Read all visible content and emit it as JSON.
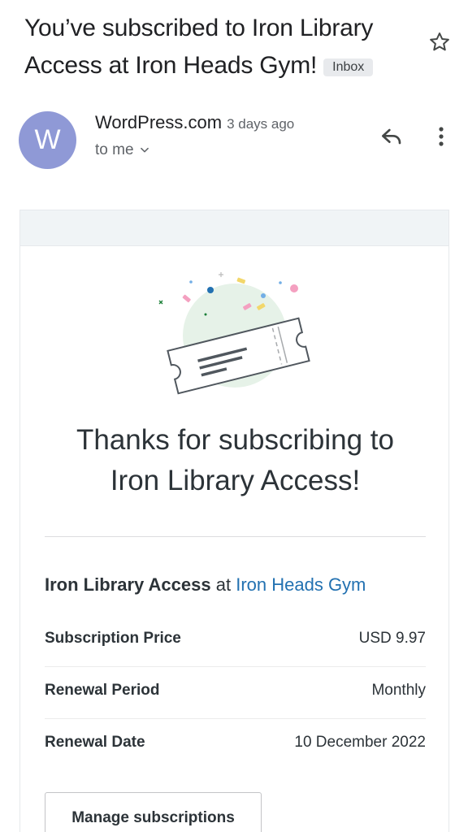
{
  "email": {
    "subject": "You’ve subscribed to Iron Library Access at Iron Heads Gym!",
    "label": "Inbox",
    "sender_initial": "W",
    "sender_name": "WordPress.com",
    "time": "3 days ago",
    "recipient": "to me"
  },
  "icons": {
    "star": "star-outline-icon",
    "reply": "reply-icon",
    "more": "more-vert-icon",
    "expand": "chevron-down-icon"
  },
  "body": {
    "thanks_line1": "Thanks for subscribing to",
    "thanks_line2": "Iron Library Access!",
    "product_name": "Iron Library Access",
    "at_word": "at",
    "site_name": "Iron Heads Gym",
    "details": [
      {
        "label": "Subscription Price",
        "value": "USD 9.97"
      },
      {
        "label": "Renewal Period",
        "value": "Monthly"
      },
      {
        "label": "Renewal Date",
        "value": "10 December 2022"
      }
    ],
    "manage_button": "Manage subscriptions"
  },
  "colors": {
    "avatar": "#8f99d6",
    "link": "#2271b1",
    "header_band": "#f0f4f6",
    "illustration_circle": "#e6f2e8"
  }
}
